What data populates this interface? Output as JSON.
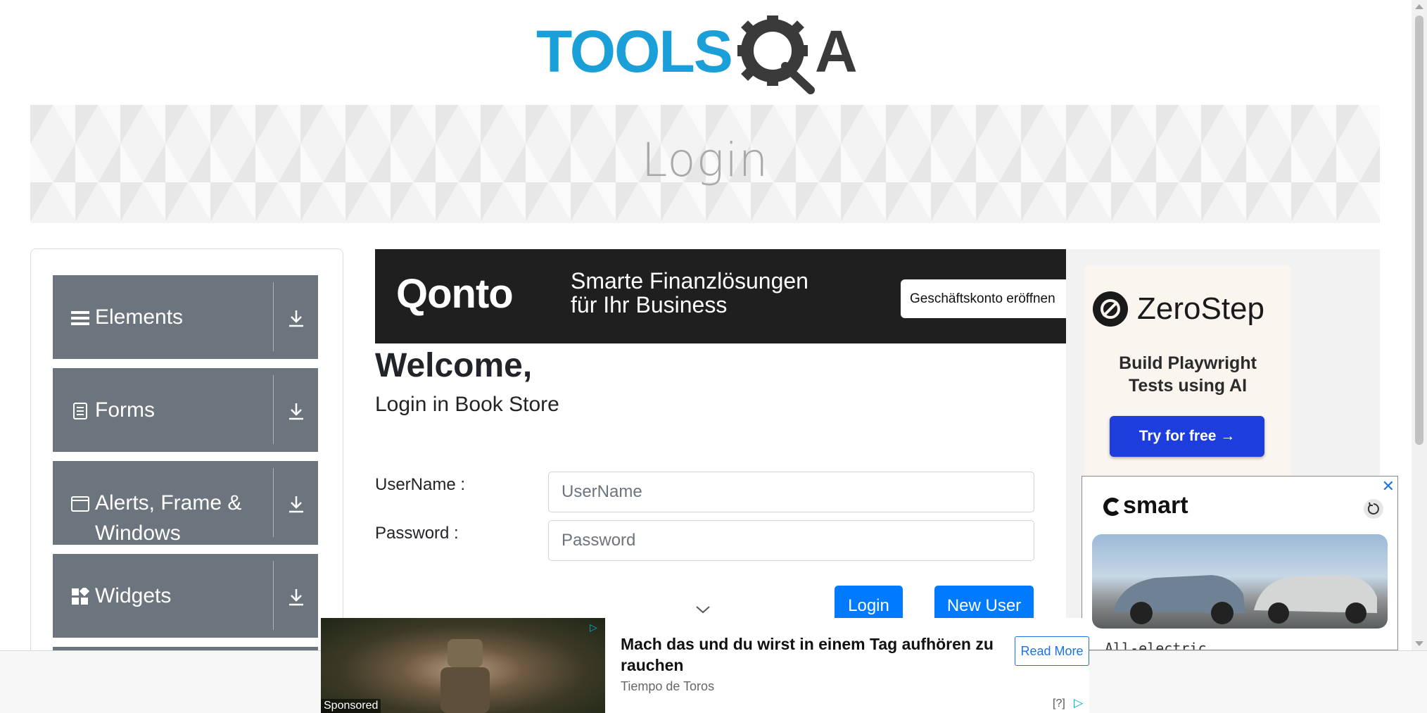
{
  "site": {
    "logo_text": "TOOLSQA",
    "logo_left": "TOOLS",
    "logo_right": "A"
  },
  "banner": {
    "title": "Login"
  },
  "sidebar": {
    "groups": [
      {
        "label": "Elements",
        "icon": "hamburger-icon"
      },
      {
        "label": "Forms",
        "icon": "document-icon"
      },
      {
        "label": "Alerts, Frame & Windows",
        "icon": "window-icon"
      },
      {
        "label": "Widgets",
        "icon": "widgets-icon"
      }
    ]
  },
  "qonto_ad": {
    "brand": "Qonto",
    "tagline_line1": "Smarte Finanzlösungen",
    "tagline_line2": "für Ihr Business",
    "cta": "Geschäftskonto eröffnen"
  },
  "form": {
    "welcome": "Welcome,",
    "subtitle": "Login in Book Store",
    "username_label": "UserName :",
    "username_placeholder": "UserName",
    "username_value": "",
    "password_label": "Password :",
    "password_placeholder": "Password",
    "password_value": "",
    "login_button": "Login",
    "new_user_button": "New User"
  },
  "zerostep_ad": {
    "name": "ZeroStep",
    "headline_line1": "Build Playwright",
    "headline_line2": "Tests using AI",
    "cta": "Try for free →"
  },
  "smart_ad": {
    "brand": "smart",
    "close": "✕",
    "bottom_text": "All-electric"
  },
  "bottom_ad": {
    "sponsored": "Sponsored",
    "headline": "Mach das und du wirst in einem Tag aufhören zu rauchen",
    "source": "Tiempo de Toros",
    "cta": "Read More",
    "help": "[?]"
  },
  "colors": {
    "logo_blue": "#1a9fd9",
    "logo_gray": "#3a3a3a",
    "sidebar_group": "#6c757d",
    "primary": "#007bff",
    "zerostep_cta": "#1d3ddc"
  }
}
